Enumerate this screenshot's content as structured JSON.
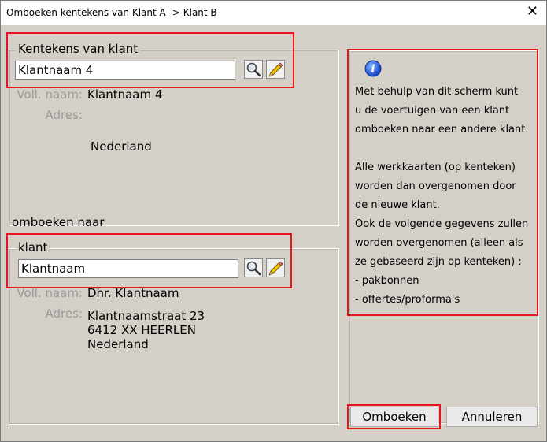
{
  "window": {
    "title": "Omboeken kentekens van Klant A -> Klant B",
    "close_glyph": "✕"
  },
  "source": {
    "legend": "Kentekens van klant",
    "field_value": "Klantnaam 4",
    "voll_naam_label": "Voll. naam:",
    "voll_naam_value": "Klantnaam 4",
    "adres_label": "Adres:",
    "country": "Nederland"
  },
  "section_label": "omboeken naar",
  "target": {
    "legend": "klant",
    "field_value": "Klantnaam",
    "voll_naam_label": "Voll. naam:",
    "voll_naam_value": "Dhr. Klantnaam",
    "adres_label": "Adres:",
    "address_line1": "Klantnaamstraat 23",
    "address_line2": "6412 XX HEERLEN",
    "country": "Nederland"
  },
  "info": {
    "icon": "info-icon",
    "lines": [
      "Met behulp van dit scherm kunt",
      "u de voertuigen van een klant",
      "omboeken naar een andere klant.",
      "",
      "Alle werkkaarten (op kenteken)",
      "worden dan overgenomen door",
      "de nieuwe klant.",
      "Ook de volgende gegevens zullen",
      "worden overgenomen (alleen als",
      "ze gebaseerd zijn op kenteken) :",
      "- pakbonnen",
      "- offertes/proforma's"
    ]
  },
  "buttons": {
    "omboeken": "Omboeken",
    "annuleren": "Annuleren"
  },
  "colors": {
    "highlight": "#e8141c",
    "dialog_bg": "#d4d0c8"
  }
}
